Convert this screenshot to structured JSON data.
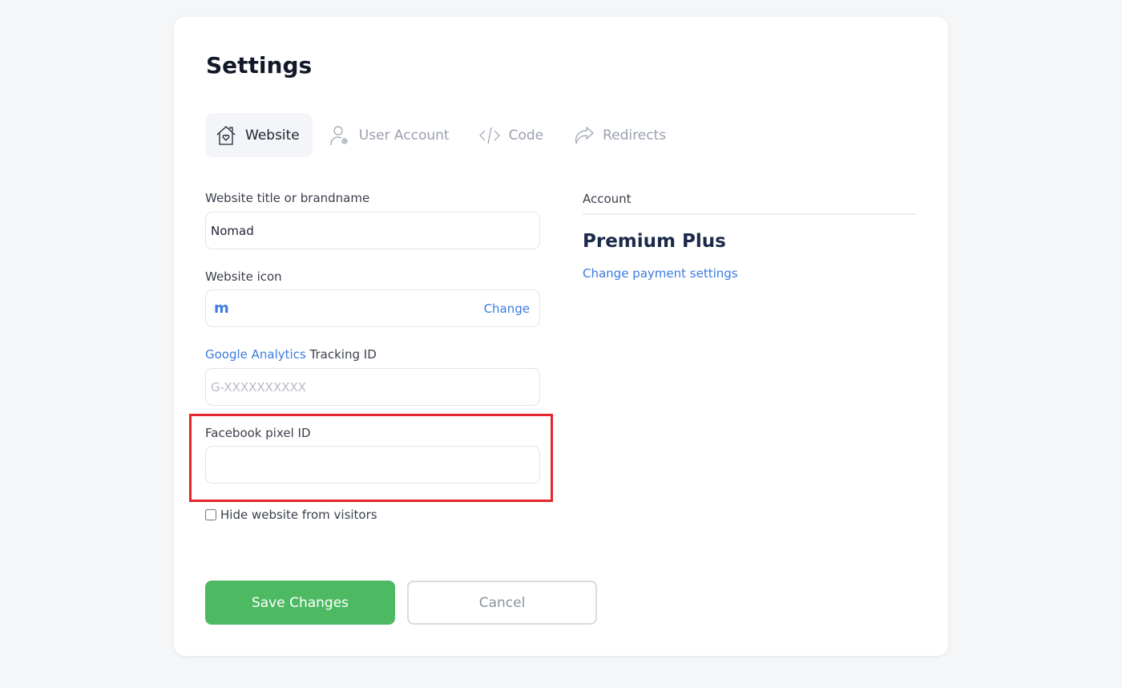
{
  "title": "Settings",
  "tabs": [
    {
      "label": "Website",
      "icon": "house-heart-icon",
      "active": true
    },
    {
      "label": "User Account",
      "icon": "user-gear-icon",
      "active": false
    },
    {
      "label": "Code",
      "icon": "code-icon",
      "active": false
    },
    {
      "label": "Redirects",
      "icon": "share-arrow-icon",
      "active": false
    }
  ],
  "form": {
    "site_title_label": "Website title or brandname",
    "site_title_value": "Nomad",
    "icon_label": "Website icon",
    "icon_glyph": "m",
    "icon_change": "Change",
    "ga_link": "Google Analytics",
    "ga_label_rest": " Tracking ID",
    "ga_placeholder": "G-XXXXXXXXXX",
    "fb_label": "Facebook pixel ID",
    "fb_value": "",
    "hide_label": "Hide website from visitors",
    "hide_checked": false
  },
  "account": {
    "label": "Account",
    "plan": "Premium Plus",
    "payment_link": "Change payment settings"
  },
  "buttons": {
    "save": "Save Changes",
    "cancel": "Cancel"
  },
  "colors": {
    "accent": "#3b7be0",
    "save": "#4dba63",
    "highlight": "#e3262b"
  }
}
